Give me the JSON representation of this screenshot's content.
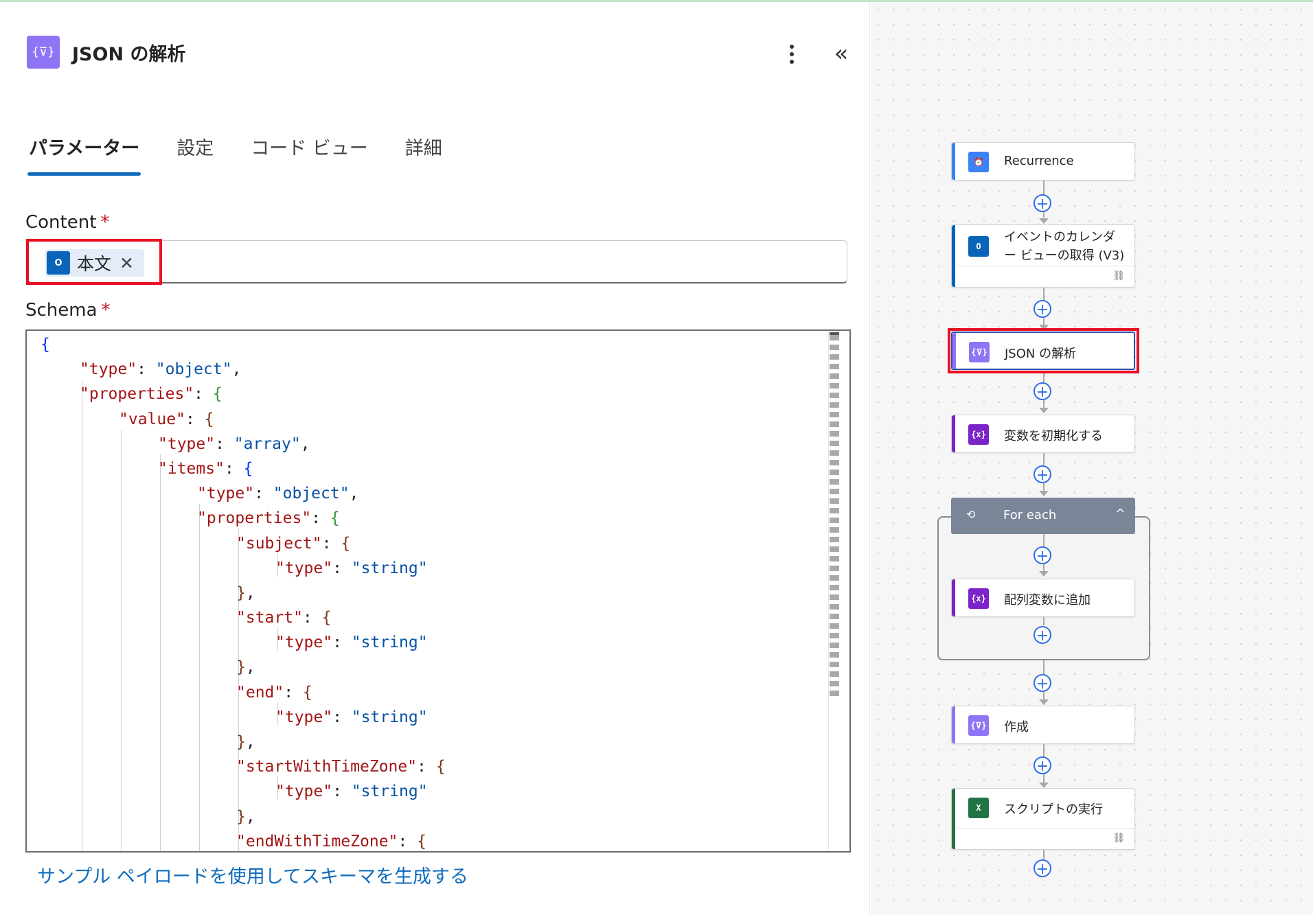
{
  "panel": {
    "icon": "{⊽}",
    "title": "JSON の解析",
    "tabs": [
      "パラメーター",
      "設定",
      "コード ビュー",
      "詳細"
    ],
    "content_label": "Content",
    "required_mark": "*",
    "content_token": {
      "icon_text": "O",
      "label": "本文",
      "close": "✕"
    },
    "schema_label": "Schema",
    "schema_lines": [
      [
        [
          "b1",
          "{"
        ]
      ],
      [
        [
          "k",
          "\"type\""
        ],
        [
          "p",
          ": "
        ],
        [
          "s",
          "\"object\""
        ],
        [
          "p",
          ","
        ]
      ],
      [
        [
          "k",
          "\"properties\""
        ],
        [
          "p",
          ": "
        ],
        [
          "b2",
          "{"
        ]
      ],
      [
        [
          "k",
          "\"value\""
        ],
        [
          "p",
          ": "
        ],
        [
          "b3",
          "{"
        ]
      ],
      [
        [
          "k",
          "\"type\""
        ],
        [
          "p",
          ": "
        ],
        [
          "s",
          "\"array\""
        ],
        [
          "p",
          ","
        ]
      ],
      [
        [
          "k",
          "\"items\""
        ],
        [
          "p",
          ": "
        ],
        [
          "b1",
          "{"
        ]
      ],
      [
        [
          "k",
          "\"type\""
        ],
        [
          "p",
          ": "
        ],
        [
          "s",
          "\"object\""
        ],
        [
          "p",
          ","
        ]
      ],
      [
        [
          "k",
          "\"properties\""
        ],
        [
          "p",
          ": "
        ],
        [
          "b2",
          "{"
        ]
      ],
      [
        [
          "k",
          "\"subject\""
        ],
        [
          "p",
          ": "
        ],
        [
          "b3",
          "{"
        ]
      ],
      [
        [
          "k",
          "\"type\""
        ],
        [
          "p",
          ": "
        ],
        [
          "s",
          "\"string\""
        ]
      ],
      [
        [
          "b3",
          "}"
        ],
        [
          "p",
          ","
        ]
      ],
      [
        [
          "k",
          "\"start\""
        ],
        [
          "p",
          ": "
        ],
        [
          "b3",
          "{"
        ]
      ],
      [
        [
          "k",
          "\"type\""
        ],
        [
          "p",
          ": "
        ],
        [
          "s",
          "\"string\""
        ]
      ],
      [
        [
          "b3",
          "}"
        ],
        [
          "p",
          ","
        ]
      ],
      [
        [
          "k",
          "\"end\""
        ],
        [
          "p",
          ": "
        ],
        [
          "b3",
          "{"
        ]
      ],
      [
        [
          "k",
          "\"type\""
        ],
        [
          "p",
          ": "
        ],
        [
          "s",
          "\"string\""
        ]
      ],
      [
        [
          "b3",
          "}"
        ],
        [
          "p",
          ","
        ]
      ],
      [
        [
          "k",
          "\"startWithTimeZone\""
        ],
        [
          "p",
          ": "
        ],
        [
          "b3",
          "{"
        ]
      ],
      [
        [
          "k",
          "\"type\""
        ],
        [
          "p",
          ": "
        ],
        [
          "s",
          "\"string\""
        ]
      ],
      [
        [
          "b3",
          "}"
        ],
        [
          "p",
          ","
        ]
      ],
      [
        [
          "k",
          "\"endWithTimeZone\""
        ],
        [
          "p",
          ": "
        ],
        [
          "b3",
          "{"
        ]
      ]
    ],
    "schema_indents": [
      0,
      1,
      1,
      2,
      3,
      3,
      4,
      4,
      5,
      6,
      5,
      5,
      6,
      5,
      5,
      6,
      5,
      5,
      6,
      5,
      5
    ],
    "generate_link": "サンプル ペイロードを使用してスキーマを生成する"
  },
  "flow": {
    "nodes": [
      {
        "id": "recurrence",
        "label": "Recurrence",
        "icon": "clock-icon",
        "icon_text": "⏰",
        "color": "#3b82f6"
      },
      {
        "id": "get-calendar-view",
        "label_line1": "イベントのカレンダ",
        "label_line2": "ー ビューの取得 (V3)",
        "icon": "outlook-icon",
        "icon_text": "O",
        "color": "#0a64ba"
      },
      {
        "id": "parse-json",
        "label": "JSON の解析",
        "icon": "data-operation-icon",
        "icon_text": "{⊽}",
        "color": "#8f74f5"
      },
      {
        "id": "init-variable",
        "label": "変数を初期化する",
        "icon": "variable-icon",
        "icon_text": "{x}",
        "color": "#7b24c9"
      },
      {
        "id": "foreach",
        "label": "For each",
        "icon": "loop-icon",
        "icon_text": "⟲",
        "color": "#7a8598"
      },
      {
        "id": "append-array",
        "label": "配列変数に追加",
        "icon": "variable-icon",
        "icon_text": "{x}",
        "color": "#7b24c9"
      },
      {
        "id": "compose",
        "label": "作成",
        "icon": "data-operation-icon",
        "icon_text": "{⊽}",
        "color": "#8f74f5"
      },
      {
        "id": "run-script",
        "label": "スクリプトの実行",
        "icon": "excel-icon",
        "icon_text": "X",
        "color": "#217346"
      }
    ],
    "plus": "+",
    "collapse_chevron": "^",
    "link_icon": "⛓"
  },
  "colors": {
    "accent": "#0f6cbd",
    "highlight": "#e81123"
  }
}
